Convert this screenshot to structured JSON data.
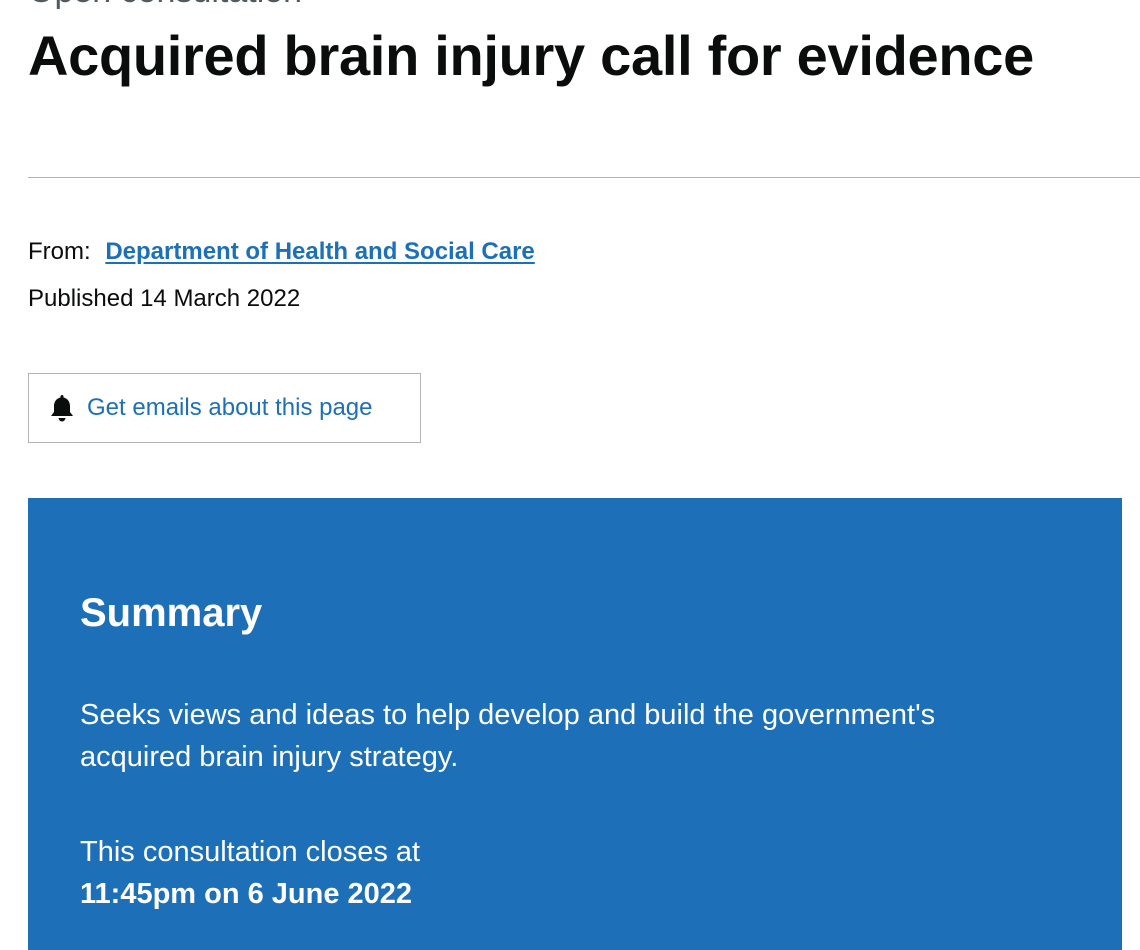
{
  "header": {
    "document_type": "Open consultation",
    "title": "Acquired brain injury call for evidence"
  },
  "metadata": {
    "from_label": "From:",
    "organisation": "Department of Health and Social Care",
    "published": "Published 14 March 2022"
  },
  "email_signup": {
    "icon": "bell-icon",
    "label": "Get emails about this page"
  },
  "summary": {
    "heading": "Summary",
    "description": "Seeks views and ideas to help develop and build the government's acquired brain injury strategy.",
    "closes_text": "This consultation closes at",
    "closes_date": "11:45pm on 6 June 2022",
    "background_color": "#1d70b8"
  },
  "colors": {
    "link": "#1d70b8",
    "text": "#0b0c0c",
    "divider": "#b1b4b6"
  }
}
